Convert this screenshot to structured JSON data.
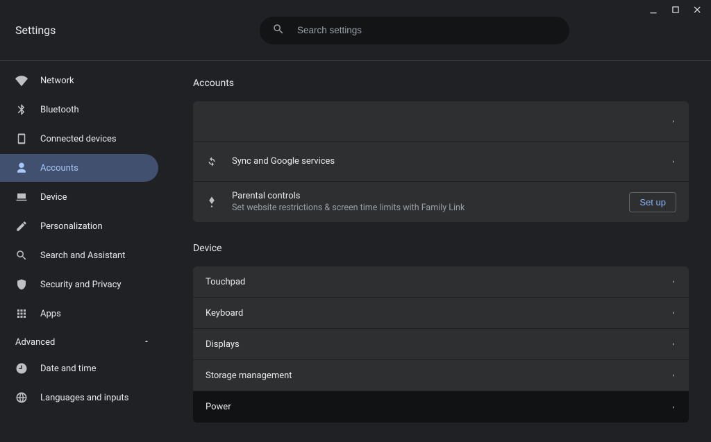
{
  "window": {
    "title": "Settings"
  },
  "search": {
    "placeholder": "Search settings"
  },
  "sidebar": {
    "items": [
      {
        "label": "Network"
      },
      {
        "label": "Bluetooth"
      },
      {
        "label": "Connected devices"
      },
      {
        "label": "Accounts"
      },
      {
        "label": "Device"
      },
      {
        "label": "Personalization"
      },
      {
        "label": "Search and Assistant"
      },
      {
        "label": "Security and Privacy"
      },
      {
        "label": "Apps"
      }
    ],
    "advanced_label": "Advanced",
    "advanced_items": [
      {
        "label": "Date and time"
      },
      {
        "label": "Languages and inputs"
      }
    ]
  },
  "sections": {
    "accounts": {
      "title": "Accounts",
      "sync_row": "Sync and Google services",
      "parental_title": "Parental controls",
      "parental_sub": "Set website restrictions & screen time limits with Family Link",
      "setup_label": "Set up"
    },
    "device": {
      "title": "Device",
      "rows": [
        "Touchpad",
        "Keyboard",
        "Displays",
        "Storage management",
        "Power"
      ]
    }
  }
}
